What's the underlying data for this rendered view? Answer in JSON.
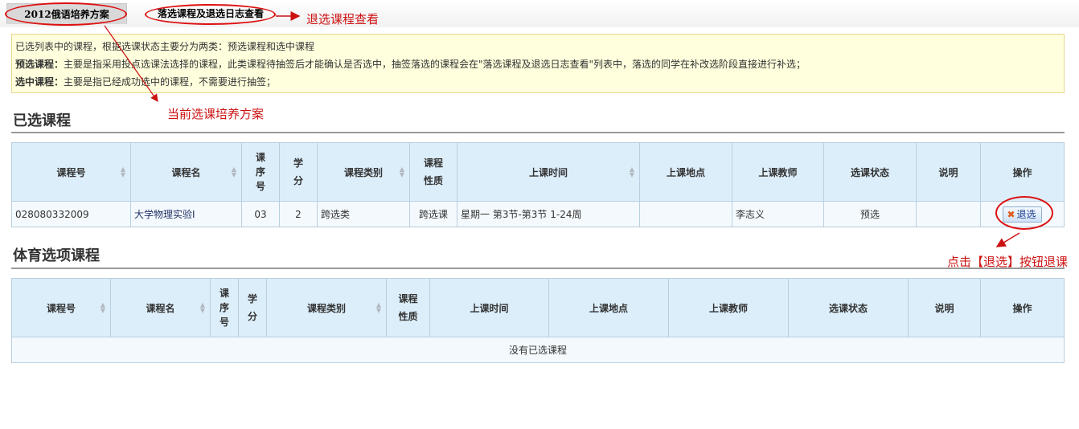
{
  "tabs": [
    {
      "label": "2012俄语培养方案"
    },
    {
      "label": "落选课程及退选日志查看"
    }
  ],
  "info": {
    "line1": "已选列表中的课程，根据选课状态主要分为两类：预选课程和选中课程",
    "line2_label": "预选课程：",
    "line2_text": "主要是指采用投点选课法选择的课程，此类课程待抽签后才能确认是否选中，抽签落选的课程会在\"落选课程及退选日志查看\"列表中，落选的同学在补改选阶段直接进行补选；",
    "line3_label": "选中课程：",
    "line3_text": "主要是指已经成功选中的课程，不需要进行抽签；"
  },
  "selected_section": {
    "title": "已选课程",
    "headers": [
      "课程号",
      "课程名",
      "课序号",
      "学分",
      "课程类别",
      "课程性质",
      "上课时间",
      "上课地点",
      "上课教师",
      "选课状态",
      "说明",
      "操作"
    ],
    "rows": [
      {
        "course_no": "028080332009",
        "course_name": "大学物理实验Ⅰ",
        "seq": "03",
        "credit": "2",
        "category": "跨选类",
        "nature": "跨选课",
        "time": "星期一  第3节-第3节  1-24周",
        "place": "",
        "teacher": "李志义",
        "status": "预选",
        "note": "",
        "action": "退选"
      }
    ]
  },
  "pe_section": {
    "title": "体育选项课程",
    "headers": [
      "课程号",
      "课程名",
      "课序号",
      "学分",
      "课程类别",
      "课程性质",
      "上课时间",
      "上课地点",
      "上课教师",
      "选课状态",
      "说明",
      "操作"
    ],
    "empty_text": "没有已选课程"
  },
  "annotations": {
    "drop_log": "退选课程查看",
    "current_plan": "当前选课培养方案",
    "click_drop": "点击【退选】按钮退课"
  },
  "colors": {
    "annotation": "#cc1111",
    "header_bg": "#dceefa",
    "info_bg": "#ffffdd"
  }
}
